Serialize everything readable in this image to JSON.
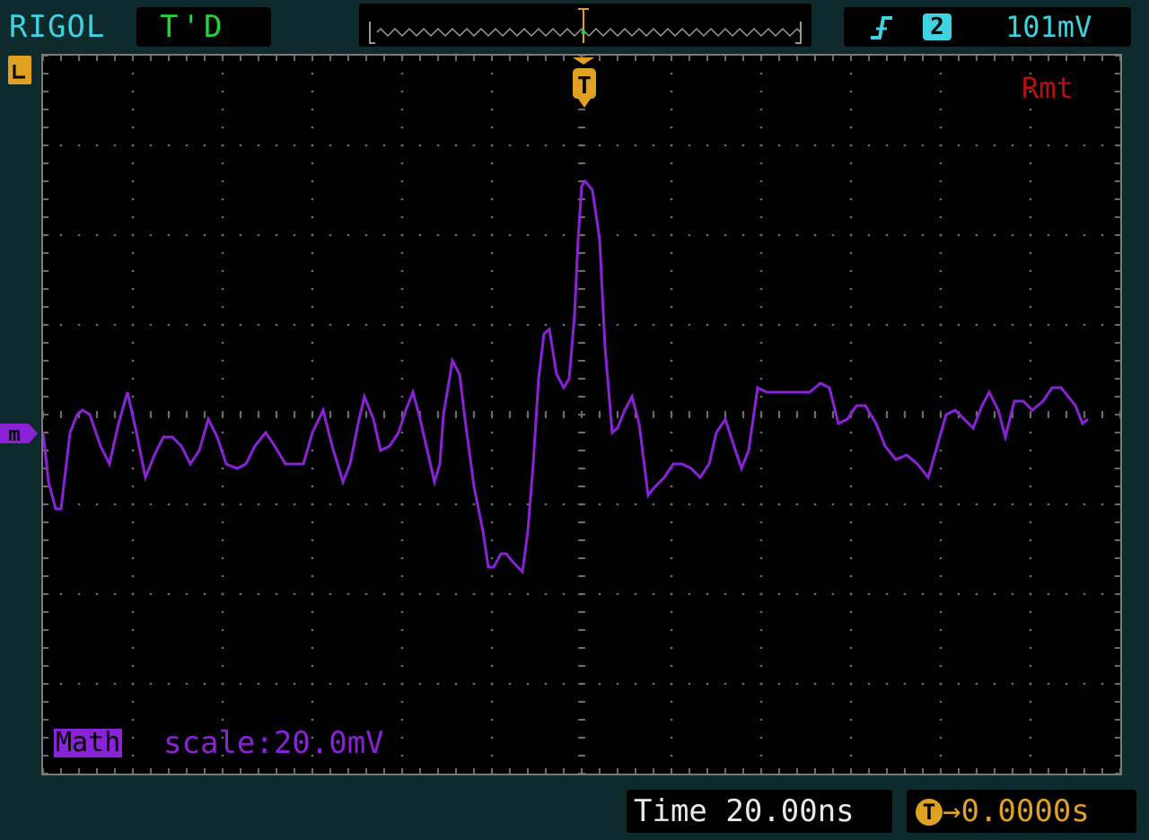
{
  "header": {
    "brand": "RIGOL",
    "status": "T'D",
    "trigger": {
      "edge_icon": "rising-edge-icon",
      "source": "2",
      "level": "101mV"
    }
  },
  "screen": {
    "mode_indicator": "Rmt",
    "trigger_marker": "T",
    "channel_marker": "m",
    "ground_marker_icon": "ground-marker-icon"
  },
  "math": {
    "label": "Math",
    "scale": "scale:20.0mV"
  },
  "footer": {
    "time": "Time 20.00ns",
    "offset_icon": "T",
    "offset": "→0.0000s"
  },
  "colors": {
    "trace": "#8a22d8",
    "accent": "#3fd2e0",
    "trigger": "#e0a020",
    "status": "#22d63a",
    "remote": "#b61010"
  },
  "chart_data": {
    "type": "line",
    "x_unit": "div",
    "y_unit": "div",
    "xlim": [
      -6,
      6
    ],
    "ylim": [
      -4,
      4
    ],
    "grid": true,
    "series": [
      {
        "values": [
          [
            -6.0,
            -0.2
          ],
          [
            -5.94,
            -0.75
          ],
          [
            -5.86,
            -1.05
          ],
          [
            -5.8,
            -1.05
          ],
          [
            -5.7,
            -0.2
          ],
          [
            -5.62,
            0.0
          ],
          [
            -5.56,
            0.05
          ],
          [
            -5.48,
            0.0
          ],
          [
            -5.36,
            -0.35
          ],
          [
            -5.26,
            -0.55
          ],
          [
            -5.16,
            -0.1
          ],
          [
            -5.06,
            0.25
          ],
          [
            -4.96,
            -0.2
          ],
          [
            -4.86,
            -0.7
          ],
          [
            -4.76,
            -0.45
          ],
          [
            -4.66,
            -0.25
          ],
          [
            -4.56,
            -0.25
          ],
          [
            -4.46,
            -0.35
          ],
          [
            -4.36,
            -0.55
          ],
          [
            -4.26,
            -0.4
          ],
          [
            -4.16,
            -0.05
          ],
          [
            -4.06,
            -0.25
          ],
          [
            -3.96,
            -0.55
          ],
          [
            -3.84,
            -0.6
          ],
          [
            -3.74,
            -0.55
          ],
          [
            -3.64,
            -0.35
          ],
          [
            -3.52,
            -0.2
          ],
          [
            -3.42,
            -0.35
          ],
          [
            -3.3,
            -0.55
          ],
          [
            -3.2,
            -0.55
          ],
          [
            -3.1,
            -0.55
          ],
          [
            -3.0,
            -0.2
          ],
          [
            -2.88,
            0.05
          ],
          [
            -2.78,
            -0.35
          ],
          [
            -2.66,
            -0.75
          ],
          [
            -2.58,
            -0.55
          ],
          [
            -2.48,
            -0.05
          ],
          [
            -2.42,
            0.2
          ],
          [
            -2.32,
            -0.05
          ],
          [
            -2.24,
            -0.4
          ],
          [
            -2.14,
            -0.35
          ],
          [
            -2.04,
            -0.2
          ],
          [
            -1.96,
            0.05
          ],
          [
            -1.88,
            0.25
          ],
          [
            -1.8,
            -0.05
          ],
          [
            -1.72,
            -0.4
          ],
          [
            -1.64,
            -0.75
          ],
          [
            -1.58,
            -0.55
          ],
          [
            -1.54,
            0.0
          ],
          [
            -1.44,
            0.6
          ],
          [
            -1.36,
            0.45
          ],
          [
            -1.3,
            -0.05
          ],
          [
            -1.2,
            -0.8
          ],
          [
            -1.1,
            -1.3
          ],
          [
            -1.04,
            -1.7
          ],
          [
            -0.98,
            -1.7
          ],
          [
            -0.9,
            -1.55
          ],
          [
            -0.84,
            -1.55
          ],
          [
            -0.76,
            -1.65
          ],
          [
            -0.66,
            -1.75
          ],
          [
            -0.6,
            -1.3
          ],
          [
            -0.54,
            -0.55
          ],
          [
            -0.48,
            0.4
          ],
          [
            -0.42,
            0.9
          ],
          [
            -0.36,
            0.95
          ],
          [
            -0.28,
            0.45
          ],
          [
            -0.2,
            0.3
          ],
          [
            -0.14,
            0.4
          ],
          [
            -0.08,
            1.1
          ],
          [
            -0.04,
            1.95
          ],
          [
            0.0,
            2.55
          ],
          [
            0.04,
            2.6
          ],
          [
            0.12,
            2.5
          ],
          [
            0.2,
            1.95
          ],
          [
            0.26,
            0.75
          ],
          [
            0.34,
            -0.2
          ],
          [
            0.4,
            -0.15
          ],
          [
            0.48,
            0.05
          ],
          [
            0.56,
            0.2
          ],
          [
            0.64,
            -0.1
          ],
          [
            0.74,
            -0.9
          ],
          [
            0.82,
            -0.8
          ],
          [
            0.92,
            -0.7
          ],
          [
            1.02,
            -0.55
          ],
          [
            1.12,
            -0.55
          ],
          [
            1.22,
            -0.6
          ],
          [
            1.32,
            -0.7
          ],
          [
            1.42,
            -0.55
          ],
          [
            1.5,
            -0.2
          ],
          [
            1.6,
            -0.05
          ],
          [
            1.68,
            -0.3
          ],
          [
            1.78,
            -0.6
          ],
          [
            1.86,
            -0.4
          ],
          [
            1.96,
            0.3
          ],
          [
            2.06,
            0.25
          ],
          [
            2.16,
            0.25
          ],
          [
            2.28,
            0.25
          ],
          [
            2.4,
            0.25
          ],
          [
            2.54,
            0.25
          ],
          [
            2.66,
            0.35
          ],
          [
            2.76,
            0.3
          ],
          [
            2.86,
            -0.1
          ],
          [
            2.96,
            -0.05
          ],
          [
            3.06,
            0.1
          ],
          [
            3.16,
            0.1
          ],
          [
            3.28,
            -0.1
          ],
          [
            3.38,
            -0.35
          ],
          [
            3.5,
            -0.5
          ],
          [
            3.62,
            -0.45
          ],
          [
            3.74,
            -0.55
          ],
          [
            3.86,
            -0.7
          ],
          [
            3.96,
            -0.35
          ],
          [
            4.06,
            0.0
          ],
          [
            4.16,
            0.05
          ],
          [
            4.26,
            -0.05
          ],
          [
            4.36,
            -0.15
          ],
          [
            4.46,
            0.1
          ],
          [
            4.54,
            0.25
          ],
          [
            4.64,
            0.05
          ],
          [
            4.72,
            -0.25
          ],
          [
            4.82,
            0.15
          ],
          [
            4.92,
            0.15
          ],
          [
            5.02,
            0.05
          ],
          [
            5.14,
            0.15
          ],
          [
            5.24,
            0.3
          ],
          [
            5.34,
            0.3
          ],
          [
            5.42,
            0.2
          ],
          [
            5.5,
            0.1
          ],
          [
            5.58,
            -0.1
          ],
          [
            5.64,
            -0.05
          ]
        ]
      }
    ]
  }
}
